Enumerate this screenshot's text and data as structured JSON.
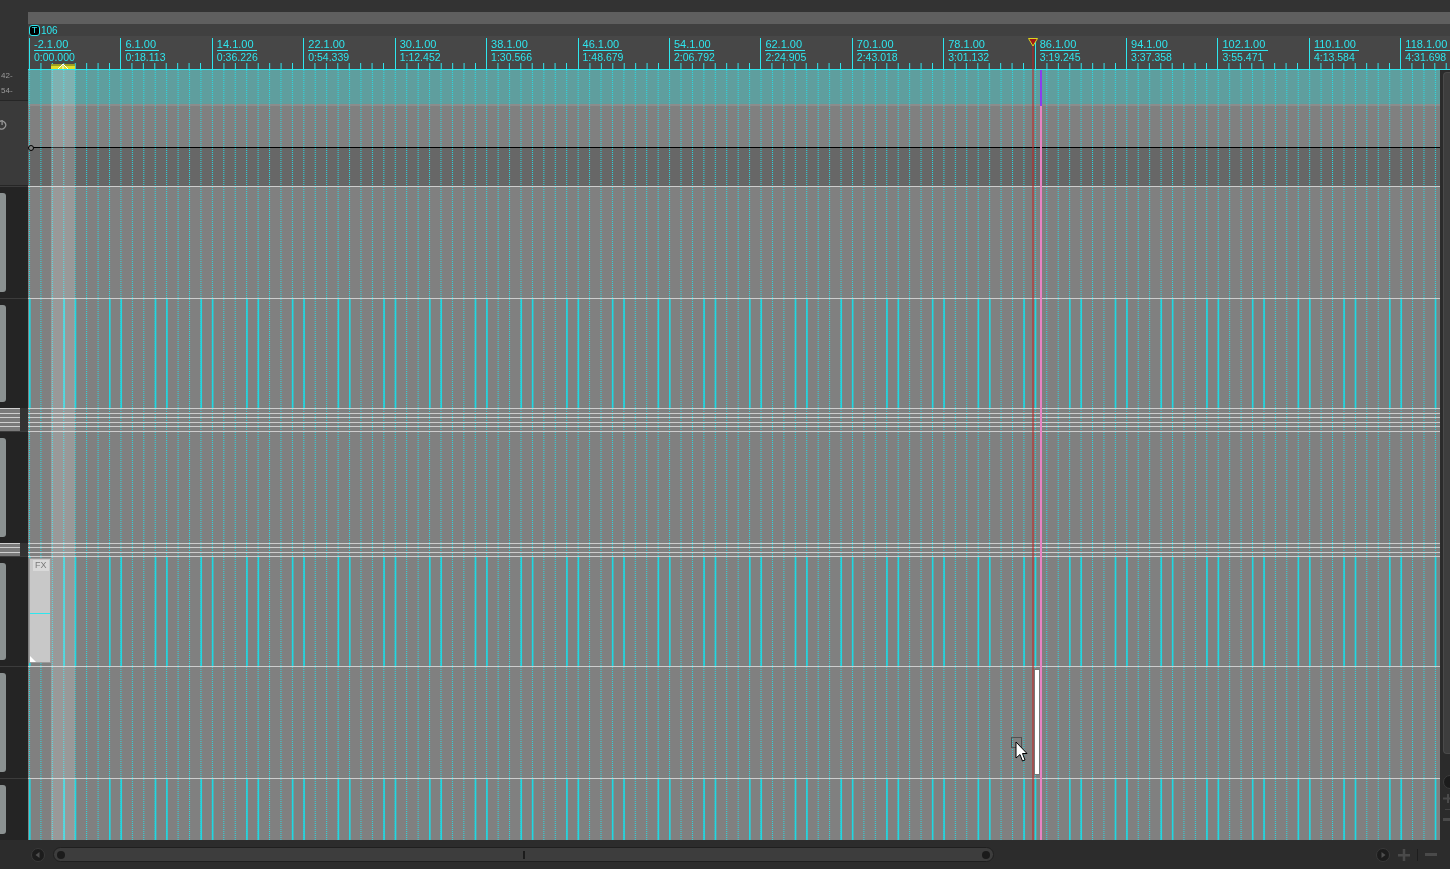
{
  "tempo_lane": {
    "marker": "T",
    "tempo": "106"
  },
  "ruler": {
    "marks": [
      {
        "bar": "-2.1.00",
        "time": "0:00.000"
      },
      {
        "bar": "6.1.00",
        "time": "0:18.113"
      },
      {
        "bar": "14.1.00",
        "time": "0:36.226"
      },
      {
        "bar": "22.1.00",
        "time": "0:54.339"
      },
      {
        "bar": "30.1.00",
        "time": "1:12.452"
      },
      {
        "bar": "38.1.00",
        "time": "1:30.566"
      },
      {
        "bar": "46.1.00",
        "time": "1:48.679"
      },
      {
        "bar": "54.1.00",
        "time": "2:06.792"
      },
      {
        "bar": "62.1.00",
        "time": "2:24.905"
      },
      {
        "bar": "70.1.00",
        "time": "2:43.018"
      },
      {
        "bar": "78.1.00",
        "time": "3:01.132"
      },
      {
        "bar": "86.1.00",
        "time": "3:19.245"
      },
      {
        "bar": "94.1.00",
        "time": "3:37.358"
      },
      {
        "bar": "102.1.00",
        "time": "3:55.471"
      },
      {
        "bar": "110.1.00",
        "time": "4:13.584"
      },
      {
        "bar": "118.1.00",
        "time": "4:31.698"
      }
    ]
  },
  "tracks": [
    {
      "kind": "envelope",
      "selected": true,
      "meter_scale": [
        "42-",
        "54-"
      ]
    },
    {
      "kind": "plain",
      "selected": false
    },
    {
      "kind": "marked",
      "selected": false
    },
    {
      "kind": "collapsed",
      "selected": false
    },
    {
      "kind": "collapsed",
      "selected": false
    },
    {
      "kind": "collapsed",
      "selected": false
    },
    {
      "kind": "collapsed",
      "selected": false
    },
    {
      "kind": "collapsed",
      "selected": false
    },
    {
      "kind": "plain",
      "selected": false
    },
    {
      "kind": "collapsed",
      "selected": false
    },
    {
      "kind": "collapsed",
      "selected": false
    },
    {
      "kind": "collapsed",
      "selected": false
    },
    {
      "kind": "marked",
      "selected": false,
      "items": [
        {
          "kind": "fx",
          "label": "FX"
        }
      ]
    },
    {
      "kind": "plain",
      "selected": false,
      "items": [
        {
          "kind": "empty"
        }
      ]
    },
    {
      "kind": "marked",
      "selected": false
    }
  ]
}
